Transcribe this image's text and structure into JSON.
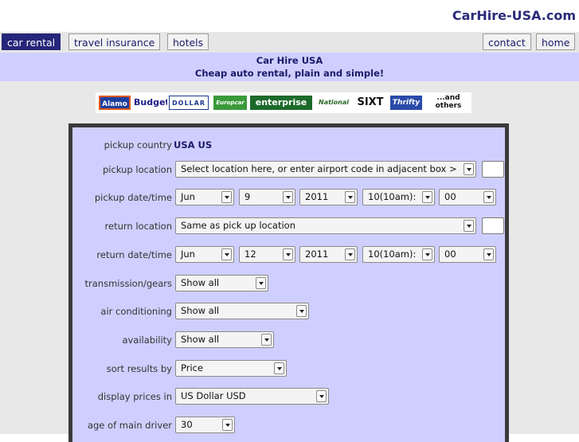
{
  "site": {
    "title": "CarHire-USA.com"
  },
  "nav": {
    "left": [
      {
        "label": "car rental",
        "active": true
      },
      {
        "label": "travel insurance"
      },
      {
        "label": "hotels"
      }
    ],
    "right": [
      {
        "label": "contact"
      },
      {
        "label": "home"
      }
    ]
  },
  "banner": {
    "line1": "Car Hire USA",
    "line2": "Cheap auto rental, plain and simple!"
  },
  "logos": [
    "Alamo",
    "Budget",
    "DOLLAR",
    "Europcar",
    "enterprise",
    "National",
    "SIXT",
    "Thrifty",
    "...and others"
  ],
  "form": {
    "pickup_country": {
      "label": "pickup country",
      "value": "USA US"
    },
    "pickup_location": {
      "label": "pickup location",
      "value": "Select location here, or enter airport code in adjacent box >"
    },
    "pickup_datetime": {
      "label": "pickup date/time",
      "month": "Jun",
      "day": "9",
      "year": "2011",
      "hour": "10(10am):",
      "minute": "00"
    },
    "return_location": {
      "label": "return location",
      "value": "Same as pick up location"
    },
    "return_datetime": {
      "label": "return date/time",
      "month": "Jun",
      "day": "12",
      "year": "2011",
      "hour": "10(10am):",
      "minute": "00"
    },
    "transmission": {
      "label": "transmission/gears",
      "value": "Show all"
    },
    "air_conditioning": {
      "label": "air conditioning",
      "value": "Show all"
    },
    "availability": {
      "label": "availability",
      "value": "Show all"
    },
    "sort": {
      "label": "sort results by",
      "value": "Price"
    },
    "currency": {
      "label": "display prices in",
      "value": "US Dollar USD"
    },
    "age": {
      "label": "age of main driver",
      "value": "30"
    }
  }
}
